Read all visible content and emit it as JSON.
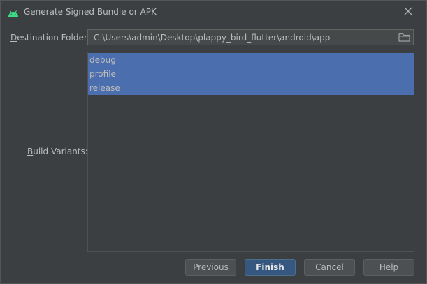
{
  "dialog": {
    "title": "Generate Signed Bundle or APK",
    "icons": {
      "app": "android-icon",
      "close": "close-icon",
      "folder": "folder-icon"
    }
  },
  "destination": {
    "label_underlined": "D",
    "label_rest": "estination Folder:",
    "value": "C:\\Users\\admin\\Desktop\\plappy_bird_flutter\\android\\app"
  },
  "build_variants": {
    "label_underlined": "B",
    "label_rest": "uild Variants:",
    "items": [
      "debug",
      "profile",
      "release"
    ],
    "selected": [
      "debug",
      "profile",
      "release"
    ]
  },
  "buttons": {
    "previous_underlined": "P",
    "previous_rest": "revious",
    "finish_underlined": "F",
    "finish_rest": "inish",
    "cancel": "Cancel",
    "help": "Help"
  },
  "colors": {
    "background": "#3c3f41",
    "selection": "#4b6eaf",
    "primary_button": "#365880",
    "android_green": "#3ddc84"
  }
}
